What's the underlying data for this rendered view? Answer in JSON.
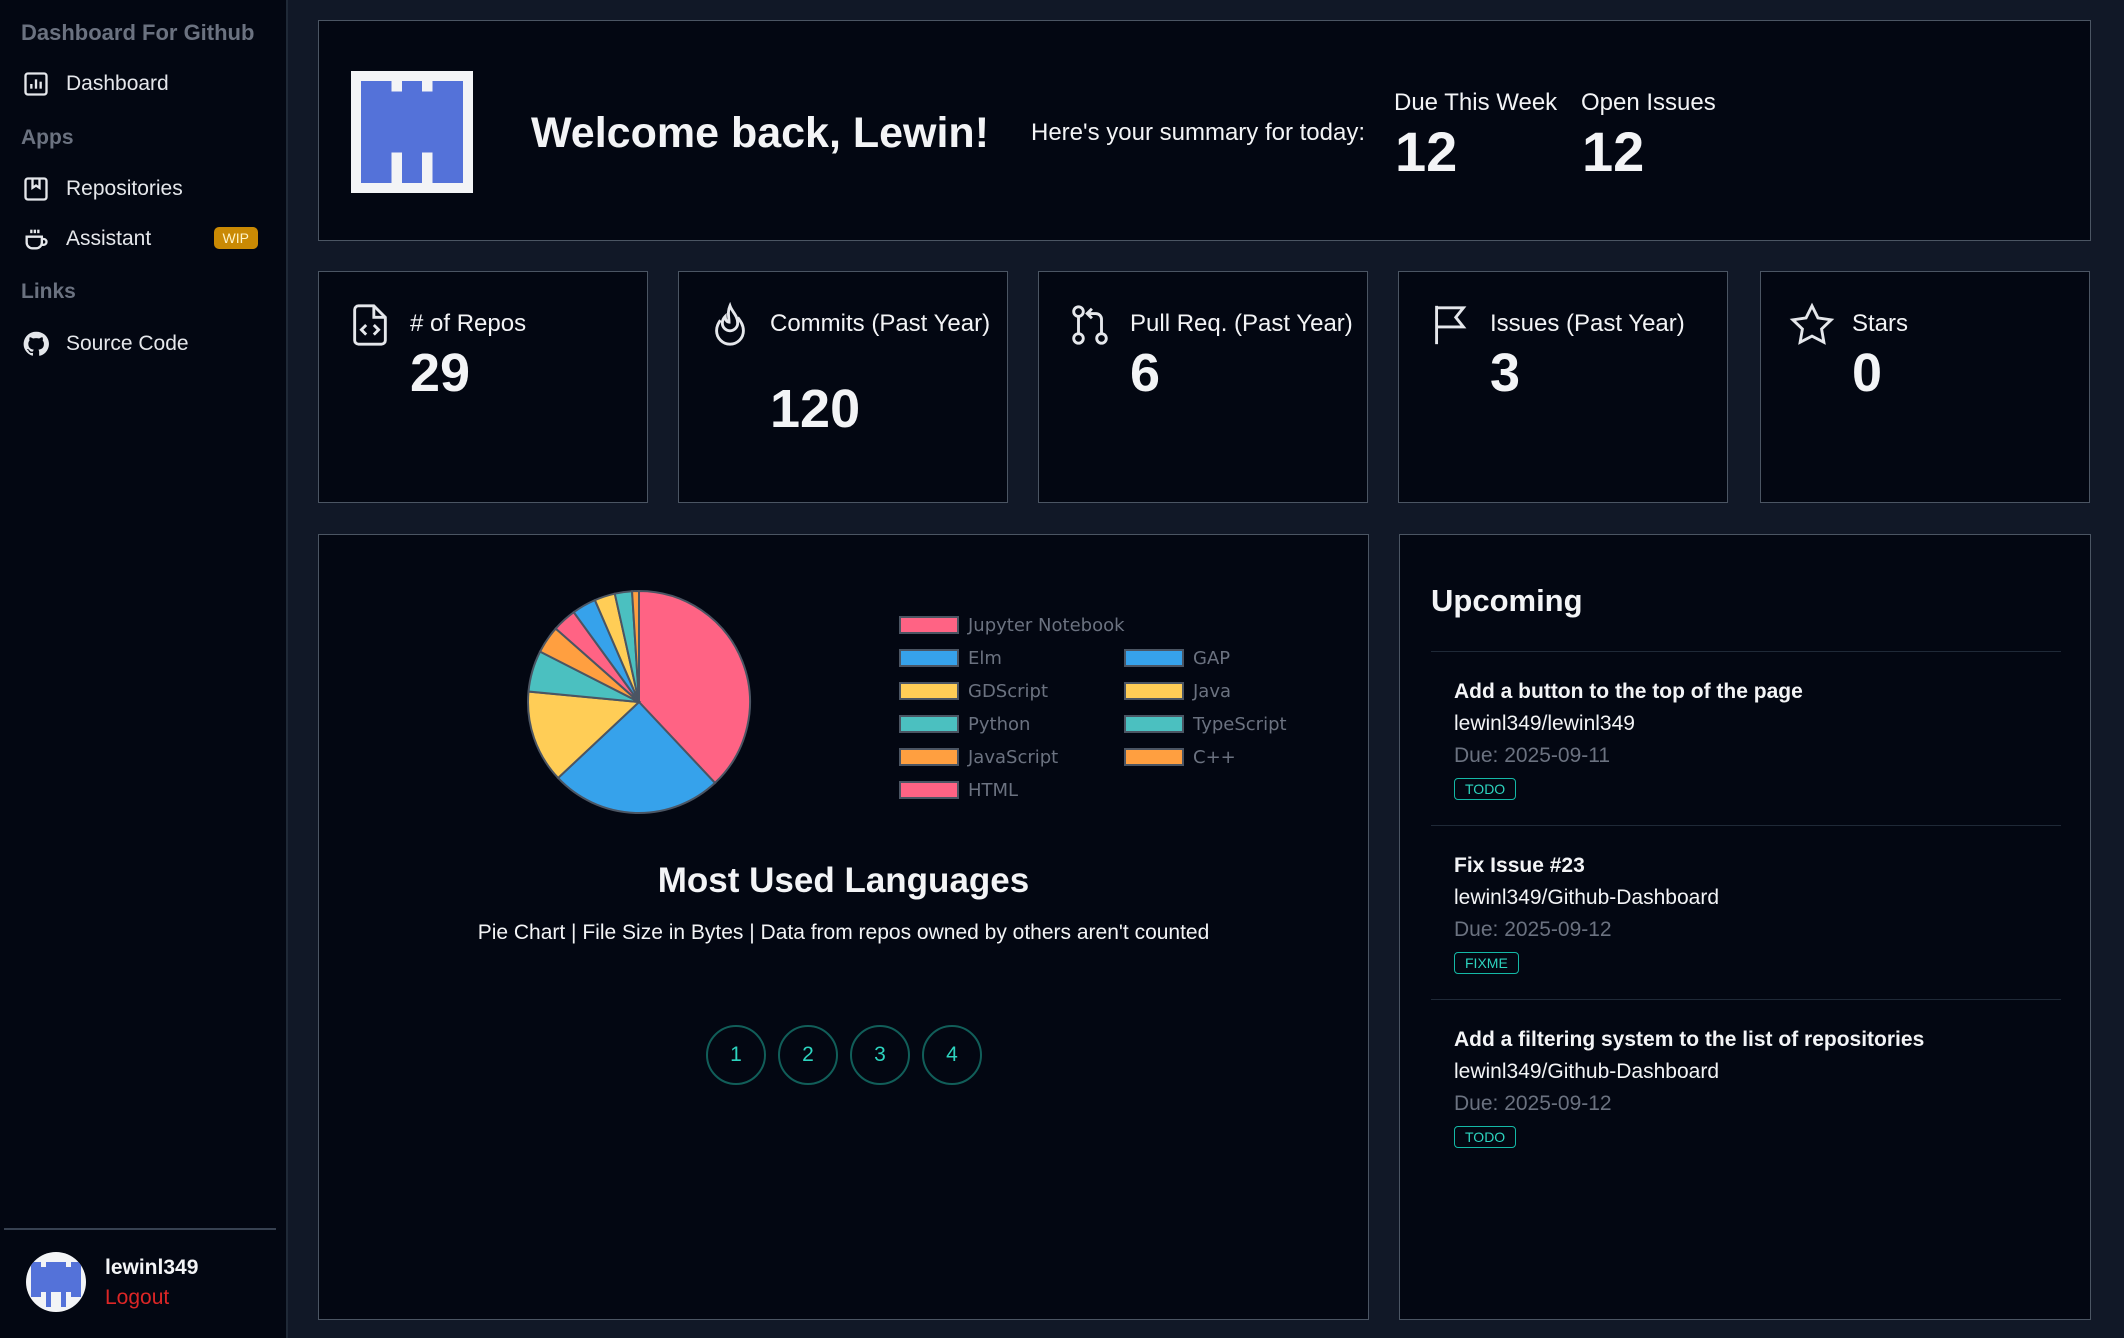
{
  "sidebar": {
    "app_title": "Dashboard For Github",
    "dashboard_label": "Dashboard",
    "apps_heading": "Apps",
    "repositories_label": "Repositories",
    "assistant_label": "Assistant",
    "wip_badge": "WIP",
    "links_heading": "Links",
    "source_code_label": "Source Code",
    "user": {
      "name": "lewinl349",
      "logout_label": "Logout"
    }
  },
  "welcome": {
    "title": "Welcome back, Lewin!",
    "subtitle": "Here's your summary for today:",
    "due_this_week_label": "Due This Week",
    "due_this_week_value": "12",
    "open_issues_label": "Open Issues",
    "open_issues_value": "12"
  },
  "stats": [
    {
      "label": "# of Repos",
      "value": "29",
      "icon": "file-code-icon"
    },
    {
      "label": "Commits (Past Year)",
      "value": "120",
      "icon": "flame-icon"
    },
    {
      "label": "Pull Req. (Past Year)",
      "value": "6",
      "icon": "git-pull-request-icon"
    },
    {
      "label": "Issues (Past Year)",
      "value": "3",
      "icon": "flag-icon"
    },
    {
      "label": "Stars",
      "value": "0",
      "icon": "star-icon"
    }
  ],
  "chart_panel": {
    "title": "Most Used Languages",
    "subtitle": "Pie Chart | File Size in Bytes | Data from repos owned by others aren't counted",
    "pages": [
      "1",
      "2",
      "3",
      "4"
    ]
  },
  "chart_data": {
    "type": "pie",
    "title": "Most Used Languages",
    "categories": [
      "Jupyter Notebook",
      "Elm",
      "GDScript",
      "Python",
      "JavaScript",
      "HTML",
      "GAP",
      "Java",
      "TypeScript",
      "C++"
    ],
    "values": [
      38.0,
      25.0,
      13.5,
      6.0,
      4.0,
      3.5,
      3.5,
      3.0,
      2.5,
      1.0
    ],
    "colors": [
      "#ff6384",
      "#36a2eb",
      "#ffcd56",
      "#4bc0c0",
      "#ff9f40",
      "#ff6384",
      "#36a2eb",
      "#ffcd56",
      "#4bc0c0",
      "#ff9f40"
    ],
    "legend_position": "right"
  },
  "upcoming": {
    "title": "Upcoming",
    "items": [
      {
        "name": "Add a button to the top of the page",
        "repo": "lewinl349/lewinl349",
        "due": "Due: 2025-09-11",
        "tag": "TODO"
      },
      {
        "name": "Fix Issue #23",
        "repo": "lewinl349/Github-Dashboard",
        "due": "Due: 2025-09-12",
        "tag": "FIXME"
      },
      {
        "name": "Add a filtering system to the list of repositories",
        "repo": "lewinl349/Github-Dashboard",
        "due": "Due: 2025-09-12",
        "tag": "TODO"
      }
    ]
  },
  "colors": {
    "accent_teal": "#2dd4bf",
    "wip_yellow": "#ca8a04",
    "logout_red": "#dc2626",
    "avatar_blue": "#5472d9"
  }
}
